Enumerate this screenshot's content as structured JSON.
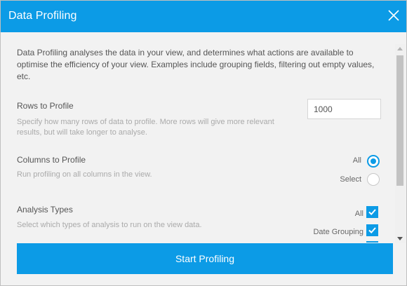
{
  "dialog": {
    "title": "Data Profiling",
    "close_icon": "close-icon",
    "intro": "Data Profiling analyses the data in your view, and determines what actions are available to optimise the efficiency of your view. Examples include grouping fields, filtering out empty values, etc."
  },
  "rows": {
    "title": "Rows to Profile",
    "description": "Specify how many rows of data to profile. More rows will give more relevant results, but will take longer to analyse.",
    "value": "1000"
  },
  "columns": {
    "title": "Columns to Profile",
    "description": "Run profiling on all columns in the view.",
    "options": [
      {
        "label": "All",
        "selected": true
      },
      {
        "label": "Select",
        "selected": false
      }
    ]
  },
  "analysis": {
    "title": "Analysis Types",
    "description": "Select which types of analysis to run on the view data.",
    "options": [
      {
        "label": "All",
        "checked": true
      },
      {
        "label": "Date Grouping",
        "checked": true
      }
    ]
  },
  "footer": {
    "start_label": "Start Profiling"
  },
  "colors": {
    "accent": "#0c9be6",
    "background": "#f2f2f2"
  }
}
